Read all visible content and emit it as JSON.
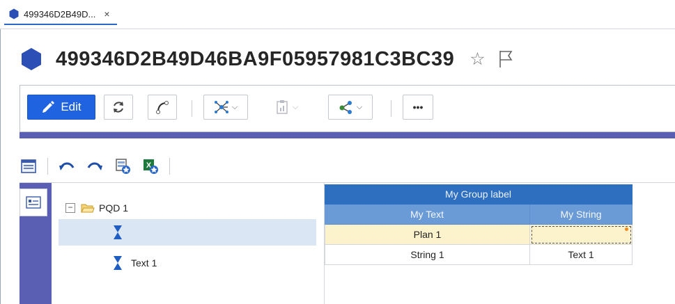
{
  "tab": {
    "label": "499346D2B49D...",
    "close": "×"
  },
  "header": {
    "title": "499346D2B49D46BA9F05957981C3BC39"
  },
  "toolbar": {
    "edit_label": "Edit",
    "more_label": "•••"
  },
  "colors": {
    "accent": "#1f63e0",
    "rail": "#5b5fb4",
    "group_header": "#2e6fbf",
    "column_header": "#6b9bd6",
    "highlight_row": "#fcf3cc",
    "selected_tree_row": "#dbe6f5"
  },
  "icons": [
    "hexagon-icon",
    "star-icon",
    "flag-icon",
    "pencil-icon",
    "refresh-icon",
    "link-icon",
    "network-icon",
    "clipboard-icon",
    "share-icon",
    "more-icon",
    "form-view-icon",
    "undo-icon",
    "redo-icon",
    "export-icon",
    "excel-icon",
    "folder-icon",
    "hourglass-icon"
  ],
  "tree": {
    "root_label": "PQD 1",
    "expander": "−",
    "items": [
      {
        "label": ""
      },
      {
        "label": "Text 1"
      }
    ]
  },
  "grid": {
    "group_label": "My Group label",
    "columns": [
      "My Text",
      "My String"
    ],
    "rows": [
      [
        "Plan 1",
        ""
      ],
      [
        "String 1",
        "Text 1"
      ]
    ]
  }
}
